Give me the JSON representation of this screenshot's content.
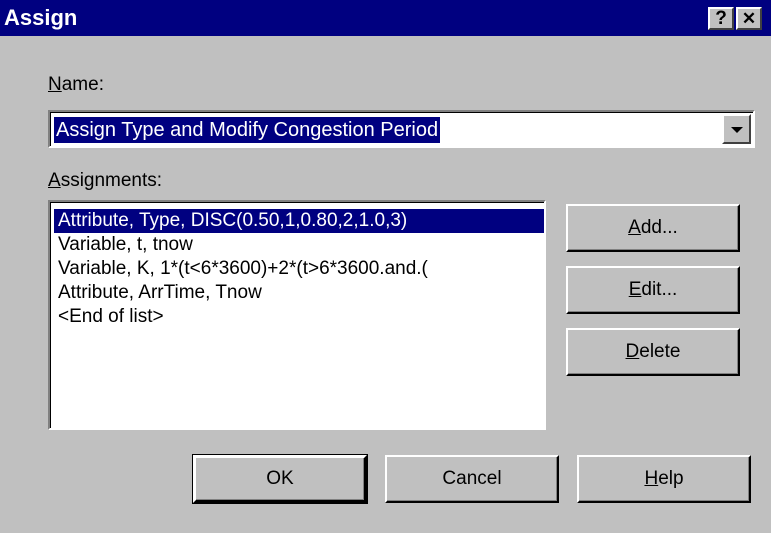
{
  "window": {
    "title": "Assign",
    "help_glyph": "?",
    "close_glyph": "✕"
  },
  "name_field": {
    "label_prefix": "",
    "label_mnemonic": "N",
    "label_rest": "ame:",
    "value": "Assign Type and Modify Congestion Period"
  },
  "assignments": {
    "label_mnemonic": "A",
    "label_rest": "ssignments:",
    "items": [
      {
        "text": "Attribute, Type, DISC(0.50,1,0.80,2,1.0,3)",
        "selected": true
      },
      {
        "text": "Variable, t, tnow",
        "selected": false
      },
      {
        "text": "Variable, K, 1*(t<6*3600)+2*(t>6*3600.and.(",
        "selected": false
      },
      {
        "text": "Attribute, ArrTime, Tnow",
        "selected": false
      },
      {
        "text": "<End of list>",
        "selected": false
      }
    ]
  },
  "side_buttons": {
    "add": {
      "mnemonic": "A",
      "rest": "dd..."
    },
    "edit": {
      "mnemonic": "E",
      "rest": "dit..."
    },
    "delete": {
      "mnemonic": "D",
      "rest": "elete"
    }
  },
  "bottom_buttons": {
    "ok": "OK",
    "cancel": "Cancel",
    "help": {
      "mnemonic": "H",
      "rest": "elp"
    }
  },
  "colors": {
    "titlebar": "#000080",
    "face": "#c0c0c0",
    "selection": "#000080"
  }
}
